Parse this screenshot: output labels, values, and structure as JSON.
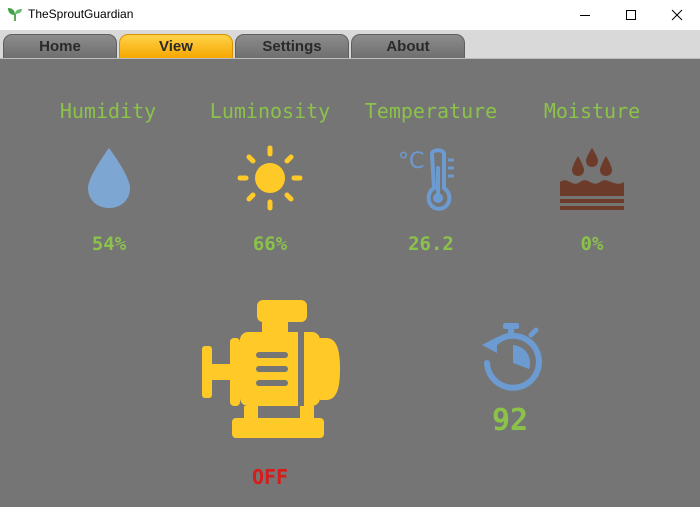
{
  "window": {
    "title": "TheSproutGuardian",
    "controls": [
      "minimize-icon",
      "maximize-icon",
      "close-icon"
    ]
  },
  "tabs": [
    {
      "label": "Home",
      "active": false
    },
    {
      "label": "View",
      "active": true
    },
    {
      "label": "Settings",
      "active": false
    },
    {
      "label": "About",
      "active": false
    }
  ],
  "sensors": [
    {
      "label": "Humidity",
      "value": "54%",
      "icon": "water-drop-icon",
      "color": "#7ea6d2"
    },
    {
      "label": "Luminosity",
      "value": "66%",
      "icon": "sun-icon",
      "color": "#ffca28"
    },
    {
      "label": "Temperature",
      "value": "26.2",
      "icon": "thermometer-icon",
      "color": "#6c9bd2"
    },
    {
      "label": "Moisture",
      "value": "0%",
      "icon": "soil-moisture-icon",
      "color": "#6d3b2a"
    }
  ],
  "pump": {
    "status": "OFF",
    "icon": "motor-pump-icon",
    "color": "#ffca28",
    "status_color": "#d81b1b"
  },
  "timer": {
    "value": "92",
    "icon": "stopwatch-icon",
    "color": "#6c9bd2"
  },
  "colors": {
    "background": "#757575",
    "text_accent": "#8bc34a",
    "active_tab": "#fbb614"
  }
}
